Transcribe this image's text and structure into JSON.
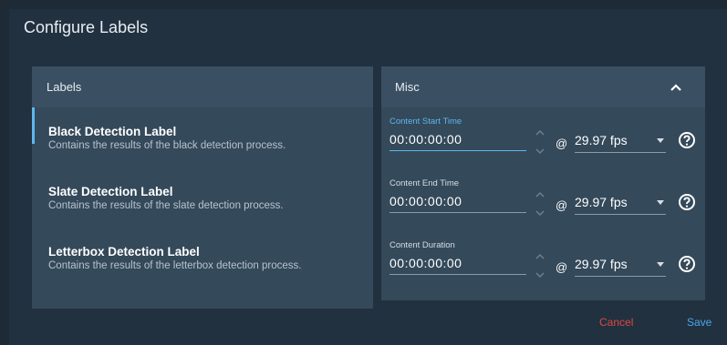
{
  "dialog": {
    "title": "Configure Labels"
  },
  "labels_panel": {
    "header": "Labels",
    "items": [
      {
        "title": "Black Detection Label",
        "description": "Contains the results of the black detection process."
      },
      {
        "title": "Slate Detection Label",
        "description": "Contains the results of the slate detection process."
      },
      {
        "title": "Letterbox Detection Label",
        "description": "Contains the results of the letterbox detection process."
      }
    ]
  },
  "misc_panel": {
    "header": "Misc",
    "fields": [
      {
        "label": "Content Start Time",
        "value": "00:00:00:00",
        "at": "@",
        "fps": "29.97 fps"
      },
      {
        "label": "Content End Time",
        "value": "00:00:00:00",
        "at": "@",
        "fps": "29.97 fps"
      },
      {
        "label": "Content Duration",
        "value": "00:00:00:00",
        "at": "@",
        "fps": "29.97 fps"
      }
    ]
  },
  "actions": {
    "cancel": "Cancel",
    "save": "Save"
  },
  "colors": {
    "accent": "#5fb6ee",
    "cancel": "#e1463f",
    "save": "#4aa6e8",
    "panel": "#34495a",
    "background": "#213140"
  },
  "icons": {
    "collapse": "chevron-up-icon",
    "spinner": "spin-arrows-icon",
    "dropdown": "caret-down-icon",
    "help": "help-circle-icon"
  }
}
